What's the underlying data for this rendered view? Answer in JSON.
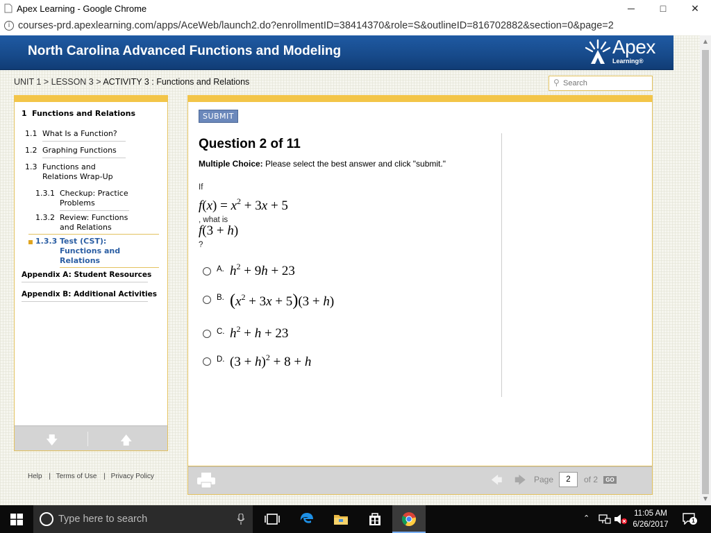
{
  "browser": {
    "window_title": "Apex Learning - Google Chrome",
    "url": "courses-prd.apexlearning.com/apps/AceWeb/launch2.do?enrollmentID=38414370&role=S&outlineID=816702882&section=0&page=2",
    "controls": {
      "minimize": "─",
      "maximize": "□",
      "close": "✕"
    }
  },
  "header": {
    "course_title": "North Carolina Advanced Functions and Modeling",
    "logo_word": "Apex",
    "logo_sub": "Learning®"
  },
  "breadcrumb": {
    "unit": "UNIT 1",
    "lesson": "LESSON 3",
    "activity": "ACTIVITY 3 : Functions and Relations",
    "sep": " > "
  },
  "search": {
    "placeholder": "Search"
  },
  "nav": {
    "section": {
      "num": "1",
      "label": "Functions and Relations"
    },
    "items": [
      {
        "num": "1.1",
        "label": "What Is a Function?"
      },
      {
        "num": "1.2",
        "label": "Graphing Functions"
      },
      {
        "num": "1.3",
        "label": "Functions and Relations Wrap-Up"
      },
      {
        "num": "1.3.1",
        "label": "Checkup: Practice Problems"
      },
      {
        "num": "1.3.2",
        "label": "Review: Functions and Relations"
      },
      {
        "num": "1.3.3",
        "label": "Test (CST): Functions and Relations"
      }
    ],
    "appendix_a": "Appendix A: Student Resources",
    "appendix_b": "Appendix B: Additional Activities"
  },
  "question": {
    "submit_label": "SUBMIT",
    "title": "Question 2 of 11",
    "type_label": "Multiple Choice:",
    "instruction": " Please select the best answer and click \"submit.\"",
    "if_text": "If",
    "what_is_text": ", what is",
    "question_mark": "?",
    "options": [
      {
        "letter": "A."
      },
      {
        "letter": "B."
      },
      {
        "letter": "C."
      },
      {
        "letter": "D."
      }
    ]
  },
  "pager": {
    "page_label": "Page",
    "page_value": "2",
    "of_label": "of 2",
    "go_label": "GO"
  },
  "footer_links": {
    "help": "Help",
    "terms": "Terms of Use",
    "privacy": "Privacy Policy",
    "sep": "|"
  },
  "taskbar": {
    "search_placeholder": "Type here to search",
    "time": "11:05 AM",
    "date": "6/26/2017",
    "notification_count": "1"
  },
  "colors": {
    "banner": "#1a5296",
    "accent_gold": "#f3c548",
    "active_nav": "#2b5ea3",
    "submit": "#6b88bb"
  }
}
